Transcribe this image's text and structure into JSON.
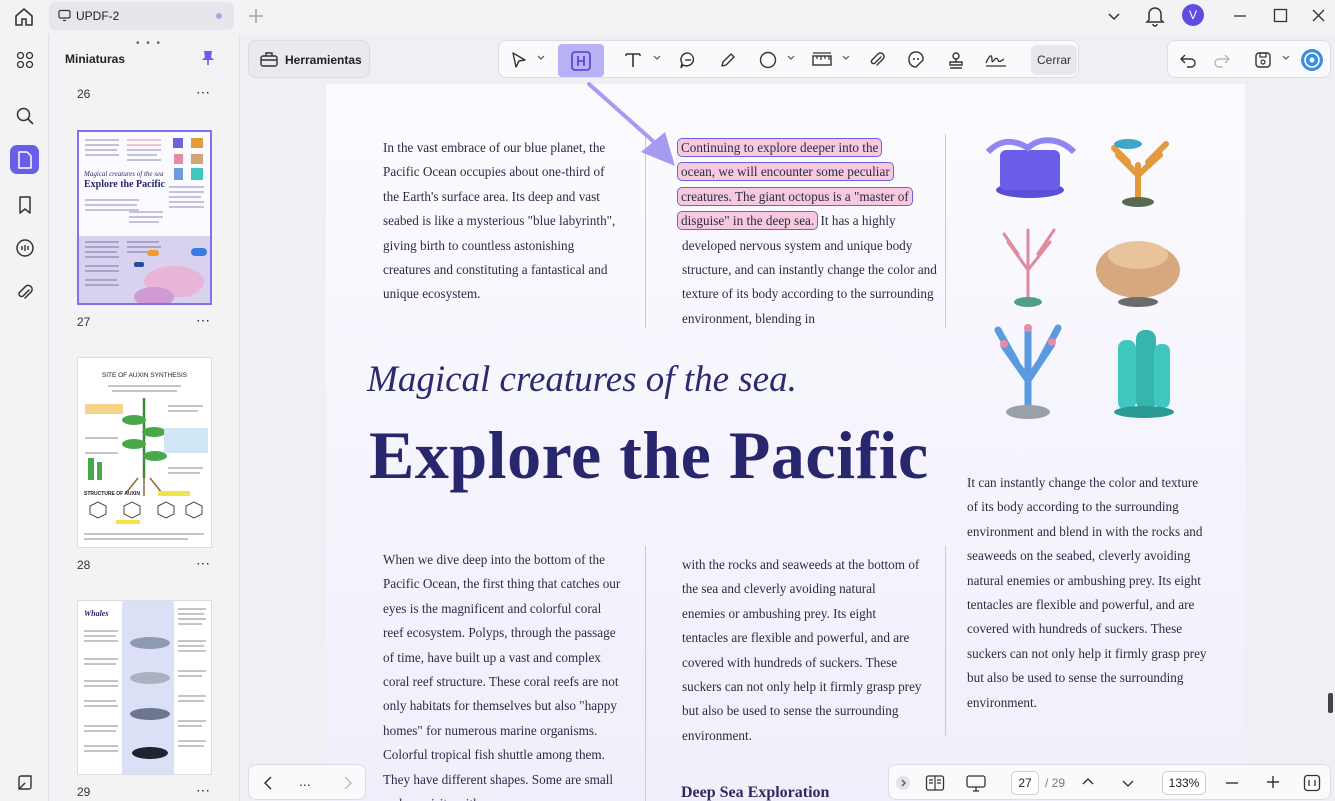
{
  "titlebar": {
    "tab_title": "UPDF-2",
    "avatar_letter": "V"
  },
  "panel": {
    "title": "Miniaturas",
    "pages": [
      {
        "label": "26"
      },
      {
        "label": "27"
      },
      {
        "label": "28"
      },
      {
        "label": "29"
      }
    ],
    "thumb28_title": "SITE OF AUXIN SYNTHESIS",
    "thumb28_sub": "STRUCTURE OF AUXIN",
    "thumb29_title": "Whales",
    "thumb27_sub": "Magical creatures of the sea",
    "thumb27_title": "Explore the Pacific"
  },
  "toolbar": {
    "tools_label": "Herramientas",
    "close_label": "Cerrar"
  },
  "document": {
    "col1_top": "In the vast embrace of our blue planet, the Pacific Ocean occupies about one-third of the Earth's surface area. Its deep and vast seabed is like a mysterious \"blue labyrinth\", giving birth to countless astonishing creatures and constituting a fantastical and unique ecosystem.",
    "highlights": [
      "Continuing to explore deeper into the",
      "ocean, we will encounter some peculiar",
      "creatures. The giant octopus is a \"master of",
      "disguise\" in the deep sea."
    ],
    "col2_top_rest": "It has a highly developed nervous system and unique body structure, and can instantly change the color and texture of its body according to the surrounding environment, blending in",
    "subtitle": "Magical creatures of the sea.",
    "title": "Explore the Pacific",
    "col1_bottom": "When we dive deep into the bottom of the Pacific Ocean, the first thing that catches our eyes is the magnificent and colorful coral reef ecosystem. Polyps, through the passage of time, have built up a vast and complex coral reef structure. These coral reefs are not only habitats for themselves but also \"happy homes\" for numerous marine organisms. Colorful tropical fish shuttle among them. They have different shapes. Some are small and exquisite with",
    "col2_bottom": "with the rocks and seaweeds at the bottom of the sea and cleverly avoiding natural enemies or ambushing prey. Its eight tentacles are flexible and powerful, and are covered with hundreds of suckers. These suckers can not only help it firmly grasp prey but also be used to sense the surrounding environment.",
    "col3_bottom": "It can instantly change the color and texture of its body according to the surrounding environment and blend in with the rocks and seaweeds on the seabed, cleverly avoiding natural enemies or ambushing prey. Its eight tentacles are flexible and powerful, and are covered with hundreds of suckers. These suckers can not only help it firmly grasp prey but also be used to sense the surrounding environment.",
    "deep_heading": "Deep Sea Exploration"
  },
  "pagination": {
    "current": "27",
    "total": "/ 29",
    "zoom": "133%",
    "more": "..."
  },
  "colors": {
    "accent": "#6a5ee8",
    "highlight": "#f6c9de",
    "title": "#28276e"
  }
}
